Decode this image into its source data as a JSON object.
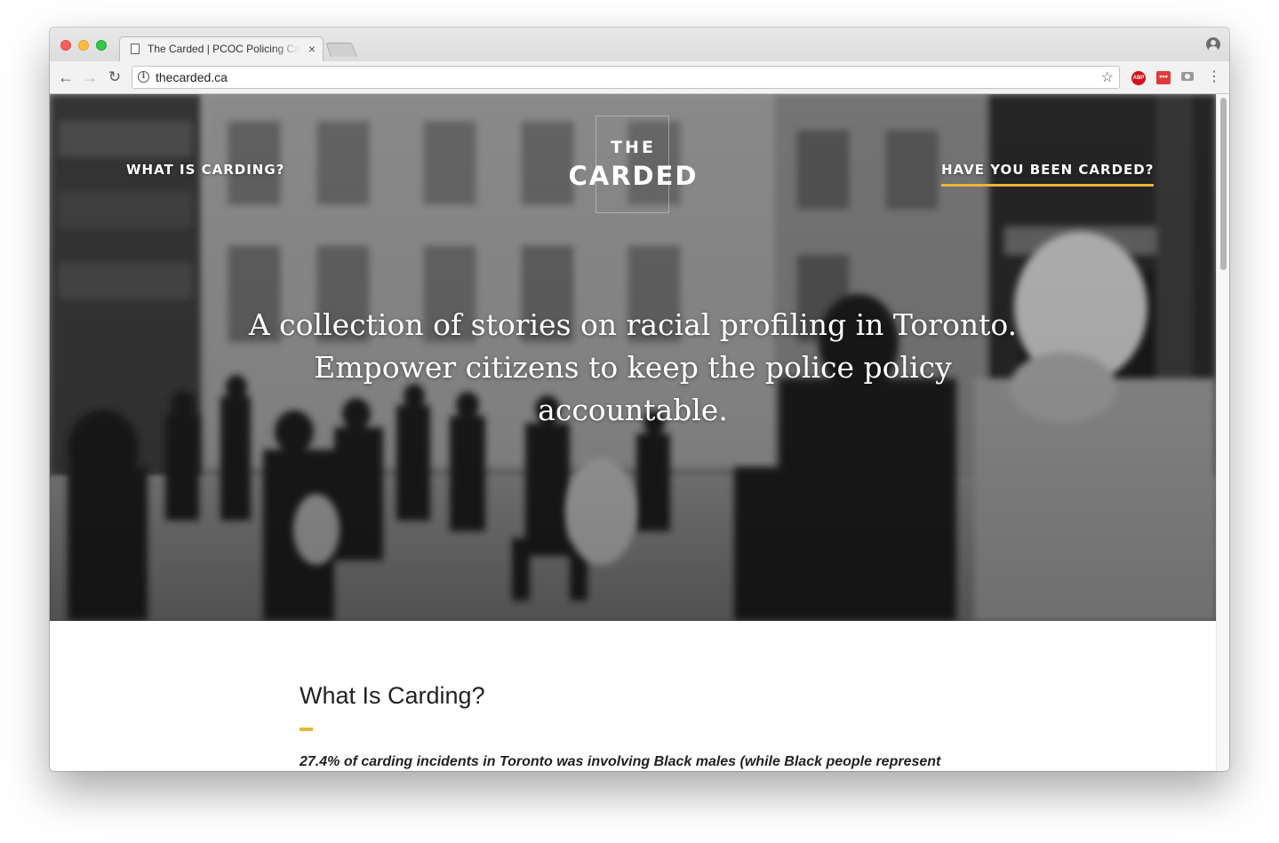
{
  "browser": {
    "tab_title": "The Carded | PCOC Policing Carding",
    "tab_close_glyph": "×",
    "url": "thecarded.ca",
    "back_glyph": "←",
    "forward_glyph": "→",
    "reload_glyph": "↻",
    "star_glyph": "☆",
    "menu_glyph": "⋮",
    "extensions": [
      {
        "name": "adblock-plus",
        "label": "ABP",
        "color": "#d4111b"
      },
      {
        "name": "red-extension",
        "label": "•••",
        "color": "#df3b3b"
      },
      {
        "name": "screenshot-camera",
        "label": "",
        "color": "#9a9a9a"
      }
    ]
  },
  "page": {
    "nav": {
      "left_link": "WHAT IS CARDING?",
      "right_link": "HAVE YOU BEEN CARDED?",
      "accent_color": "#e9b635"
    },
    "logo": {
      "line1": "THE",
      "line2": "CARDED"
    },
    "hero": {
      "tagline": "A collection of stories on racial profiling in Toronto. Empower citizens to keep the police policy accountable."
    },
    "section": {
      "title": "What Is Carding?",
      "lead": "27.4% of carding incidents in Toronto was involving Black males (while Black people represent"
    }
  }
}
